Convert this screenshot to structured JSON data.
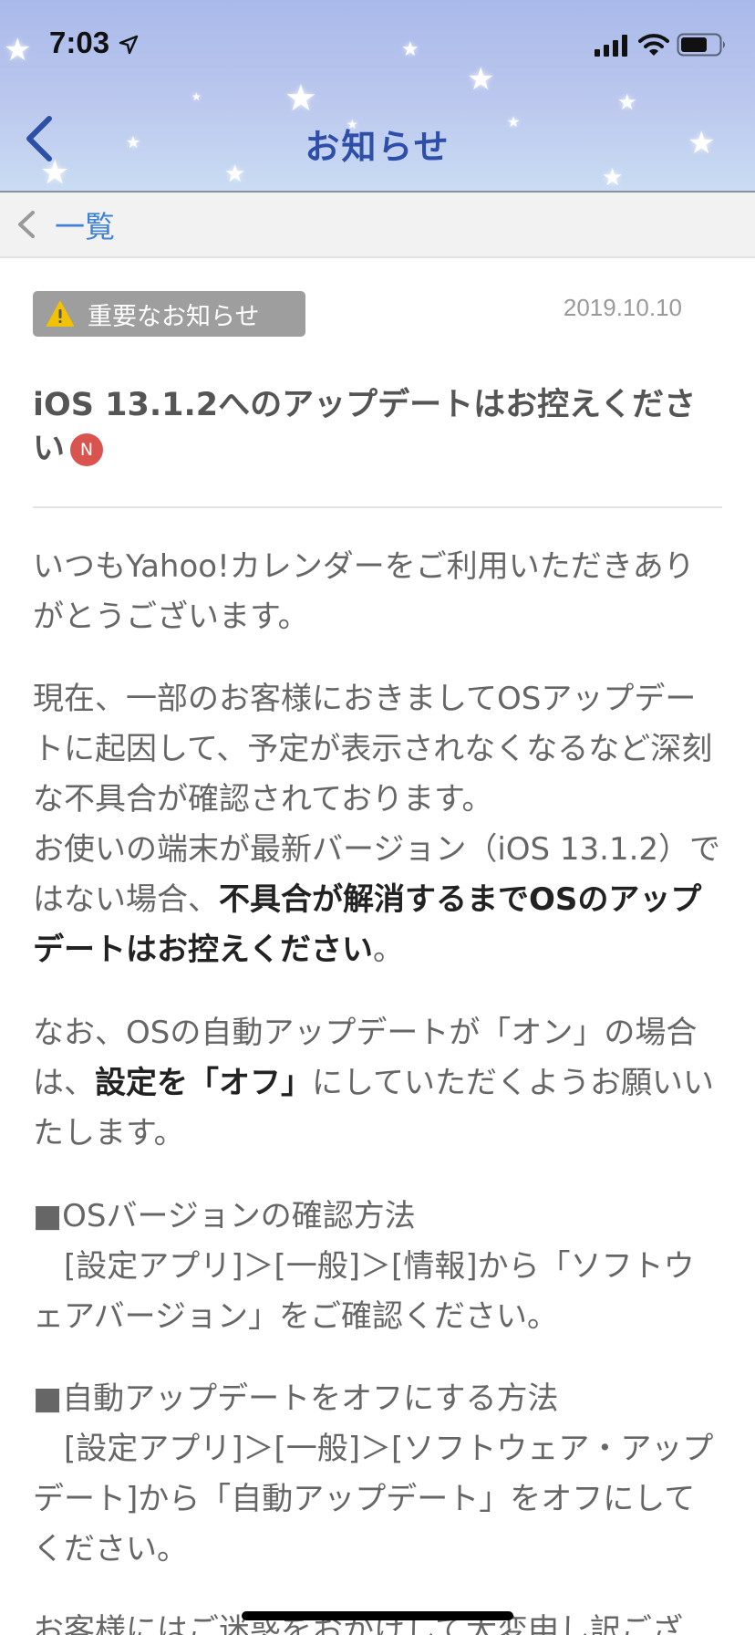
{
  "status_bar": {
    "time": "7:03",
    "icons": [
      "location-arrow-icon",
      "signal-bars-icon",
      "wifi-icon",
      "battery-icon"
    ]
  },
  "header": {
    "title": "お知らせ",
    "back_icon": "chevron-left-icon",
    "title_color": "#2d4fa8"
  },
  "subnav": {
    "list_link": "一覧",
    "link_color": "#3d82d8"
  },
  "article": {
    "badge": "重要なお知らせ",
    "badge_icon": "warning-icon",
    "date": "2019.10.10",
    "title": "iOS 13.1.2へのアップデートはお控えください",
    "new_badge": "N",
    "paragraphs": {
      "p1": "いつもYahoo!カレンダーをご利用いただきありがとうございます。",
      "p2a": "現在、一部のお客様におきましてOSアップデートに起因して、予定が表示されなくなるなど深刻な不具合が確認されております。",
      "p2b": "お使いの端末が最新バージョン（iOS 13.1.2）ではない場合、",
      "p2c": "不具合が解消するまでOSのアップデートはお控えください",
      "p2d": "。",
      "p3a": "なお、OSの自動アップデートが「オン」の場合は、",
      "p3b": "設定を「オフ」",
      "p3c": "にしていただくようお願いいたします。",
      "p4_heading": "■OSバージョンの確認方法",
      "p4_body": "　[設定アプリ]＞[一般]＞[情報]から「ソフトウェアバージョン」をご確認ください。",
      "p5_heading": "■自動アップデートをオフにする方法",
      "p5_body": "　[設定アプリ]＞[一般]＞[ソフトウェア・アップデート]から「自動アップデート」をオフにしてください。",
      "p6_partial": "お客様にはご迷惑をおかけして大変申し訳ござ"
    }
  }
}
